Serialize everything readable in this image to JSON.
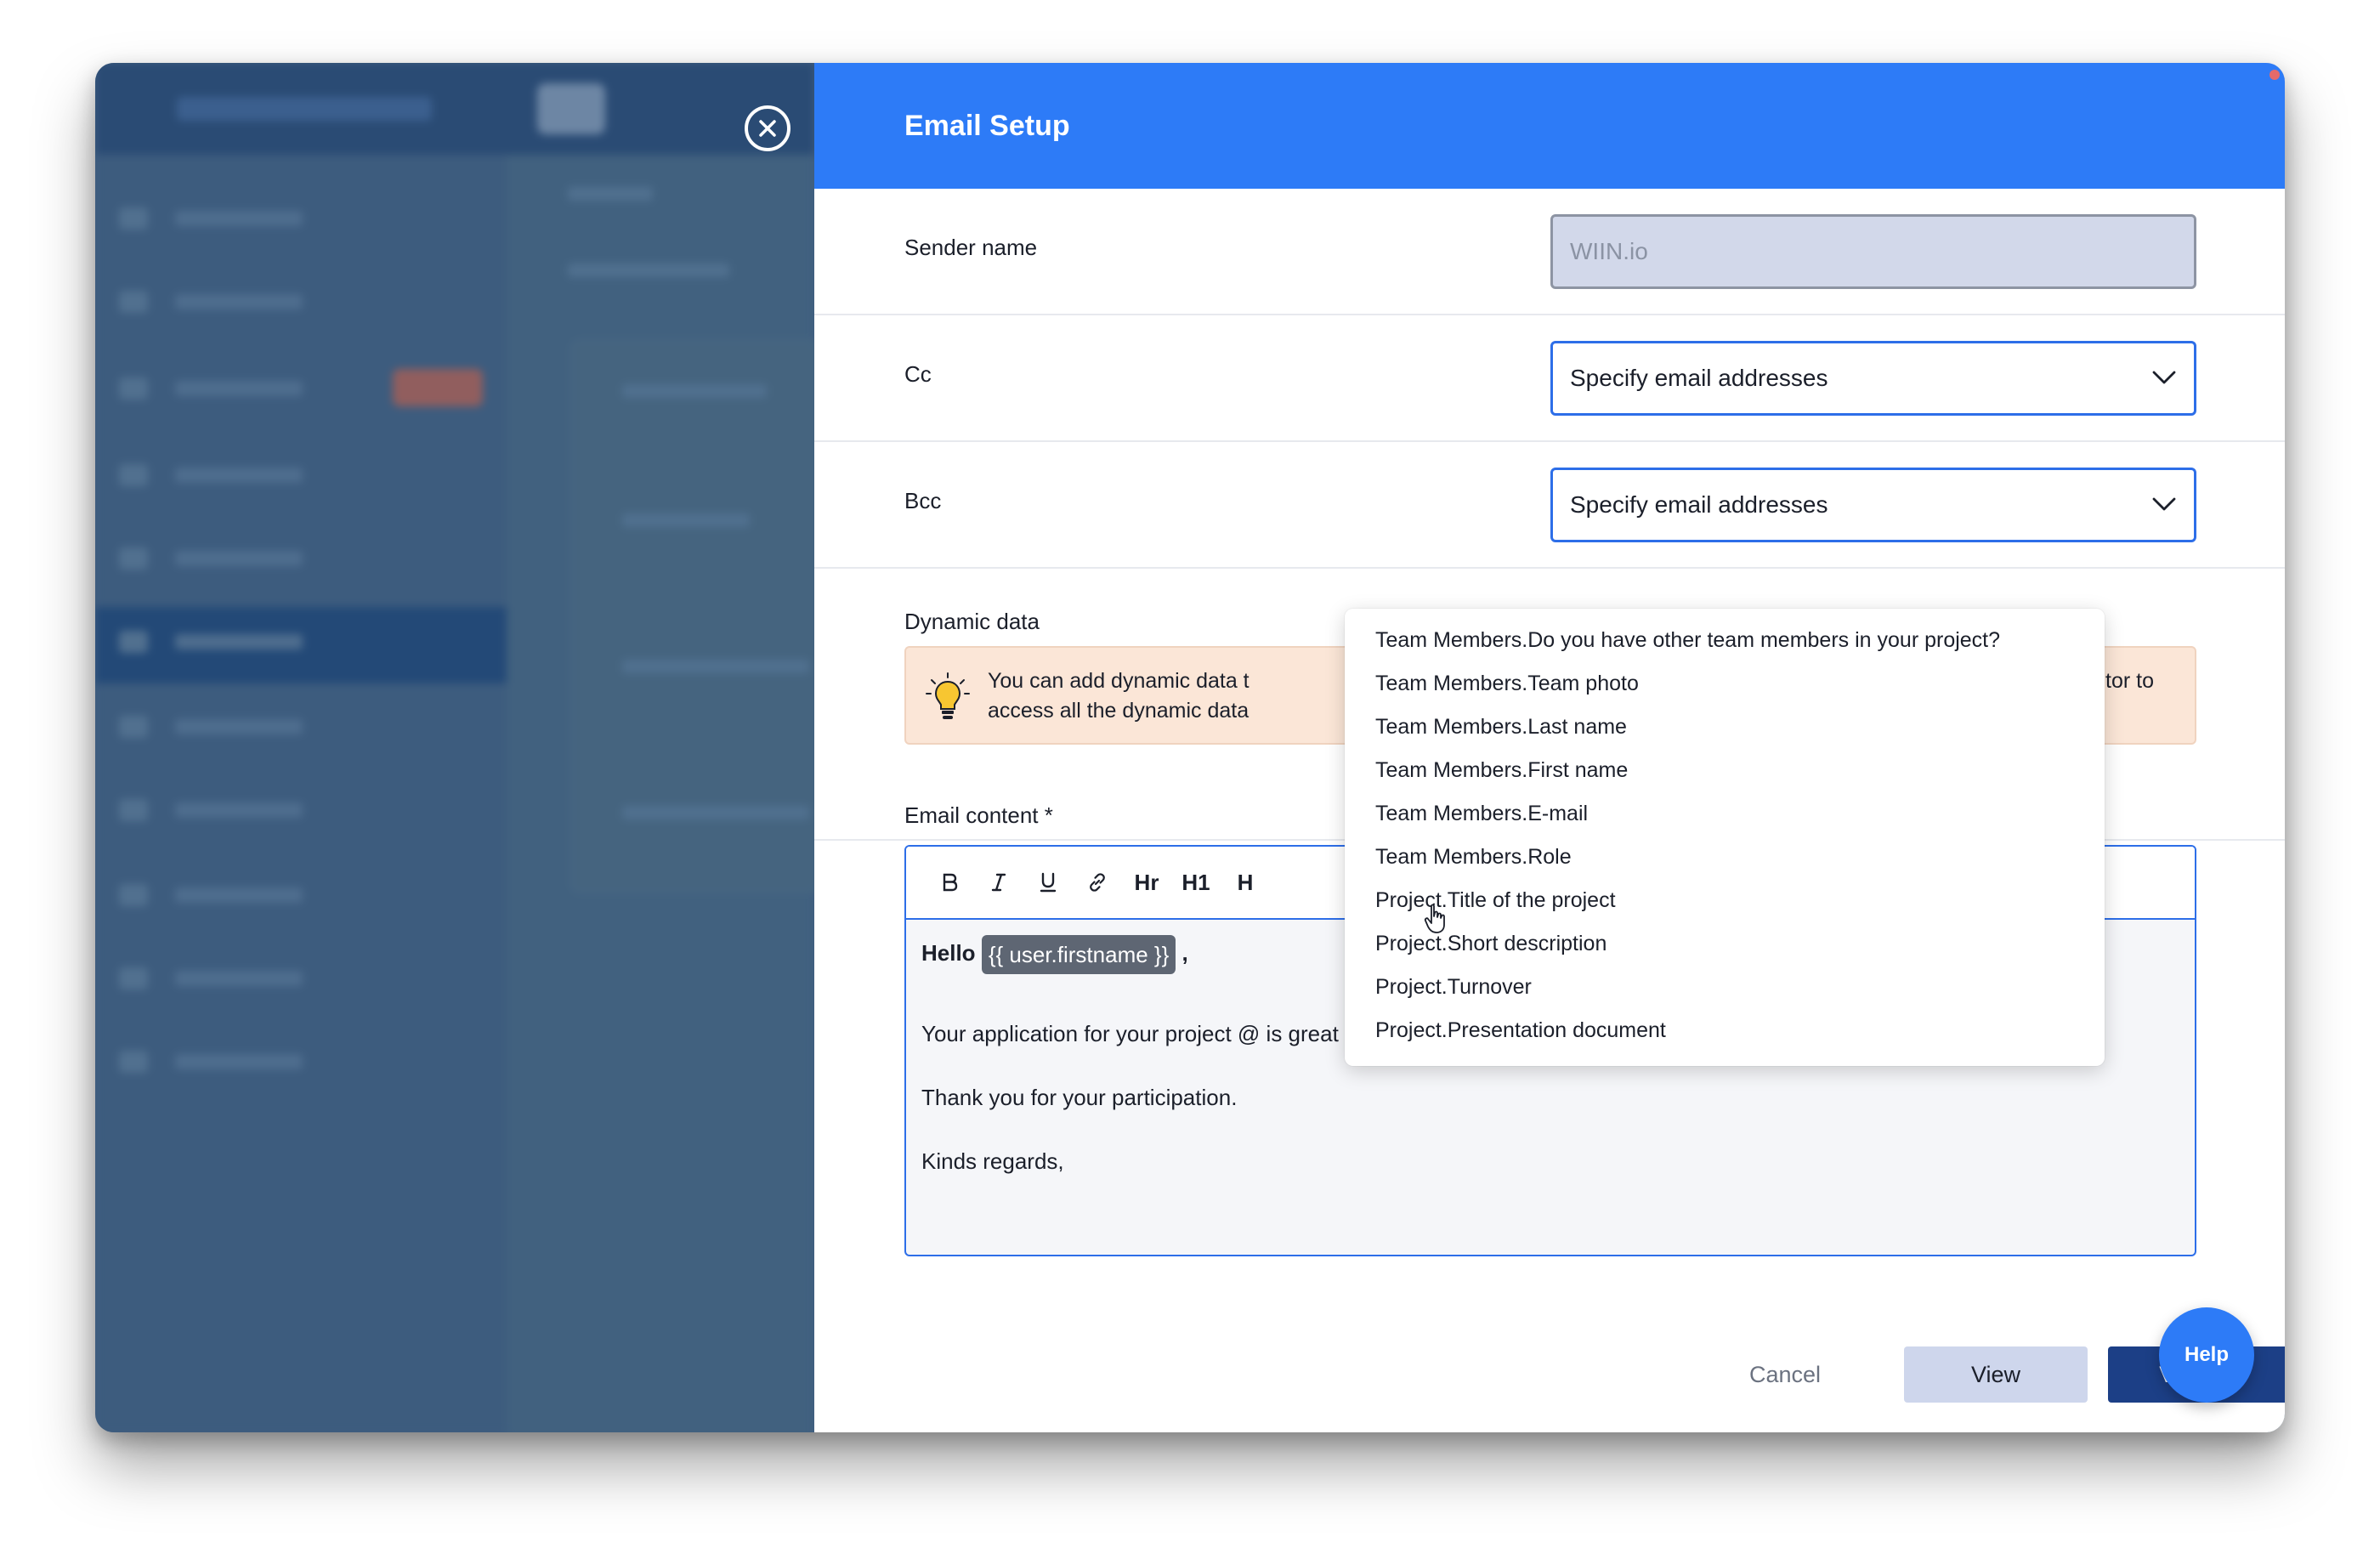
{
  "modal": {
    "title": "Email Setup",
    "sender_name": {
      "label": "Sender name",
      "value": "WIIN.io"
    },
    "cc": {
      "label": "Cc",
      "value": "Specify email addresses"
    },
    "bcc": {
      "label": "Bcc",
      "value": "Specify email addresses"
    },
    "dynamic_data": {
      "label": "Dynamic data",
      "info_line1": "You can add dynamic data t",
      "info_line2": "access all the dynamic data",
      "info_right": "in the editor to"
    },
    "email_content": {
      "label": "Email content *",
      "toolbar": {
        "hr": "Hr",
        "h1": "H1",
        "h2_partial": "H"
      },
      "greeting": "Hello",
      "tag": "{{ user.firstname }}",
      "greeting_suffix": ",",
      "line1": "Your application for your project @ is great and you have been selected!!",
      "line2": "Thank you for your participation.",
      "line3": "Kinds regards,"
    },
    "dropdown_items": [
      "Team Members.Do you have other team members in your project?",
      "Team Members.Team photo",
      "Team Members.Last name",
      "Team Members.First name",
      "Team Members.E-mail",
      "Team Members.Role",
      "Project.Title of the project",
      "Project.Short description",
      "Project.Turnover",
      "Project.Presentation document"
    ],
    "buttons": {
      "cancel": "Cancel",
      "view": "View",
      "validate": "Validate",
      "help": "Help"
    }
  },
  "icons": {
    "close": "close-circle-icon",
    "chevron": "chevron-down-icon",
    "bulb": "lightbulb-icon",
    "bold": "bold-icon",
    "italic": "italic-icon",
    "underline": "underline-icon",
    "link": "link-icon",
    "cursor": "hand-pointer-icon"
  },
  "colors": {
    "header_blue": "#2d7bf7",
    "validate_navy": "#1c3f86",
    "field_border_blue": "#2d6ee8",
    "info_bg": "#fbe6d7"
  }
}
